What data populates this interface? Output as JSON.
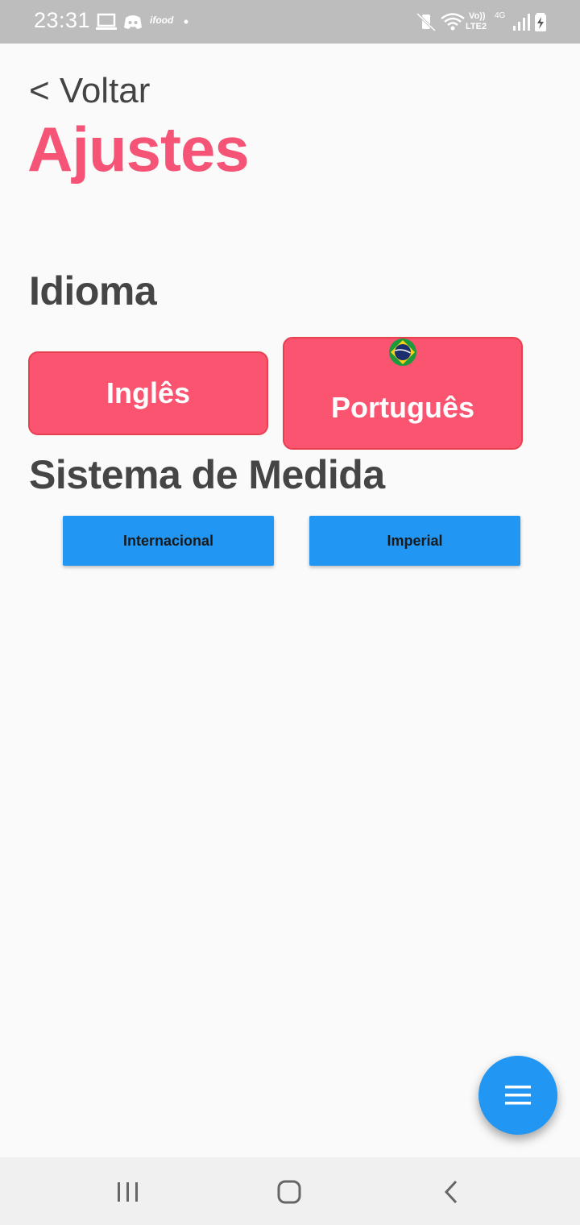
{
  "status_bar": {
    "time": "23:31",
    "icons": [
      "laptop-icon",
      "discord-icon",
      "ifood-icon",
      "dot-icon",
      "mute-vibrate-icon",
      "wifi-icon",
      "signal-icon",
      "battery-charging-icon"
    ],
    "volte_label": "Vo))",
    "lte_label": "LTE2",
    "network_label": "4G",
    "ifood_label": "ifood"
  },
  "header": {
    "back_label": "< Voltar",
    "title": "Ajustes"
  },
  "language": {
    "heading": "Idioma",
    "english_label": "Inglês",
    "portuguese_label": "Português",
    "selected_flag": "brazil-flag-icon"
  },
  "measurement": {
    "heading": "Sistema de Medida",
    "international_label": "Internacional",
    "imperial_label": "Imperial"
  },
  "fab": {
    "icon": "menu-icon"
  },
  "nav_bar": {
    "icons": [
      "recent-apps-icon",
      "home-icon",
      "back-icon"
    ]
  },
  "colors": {
    "accent": "#f55476",
    "language_button": "#fb5470",
    "primary_blue": "#2196f3",
    "heading_text": "#454545"
  }
}
